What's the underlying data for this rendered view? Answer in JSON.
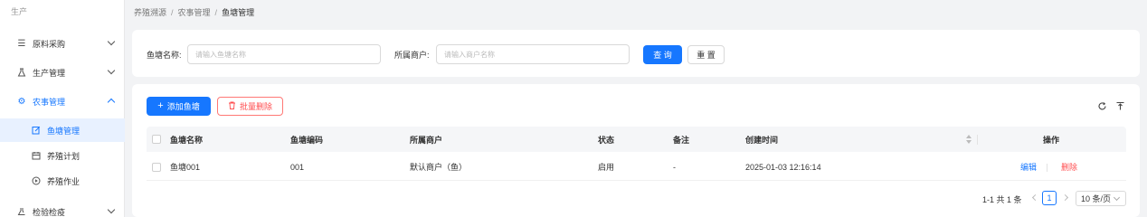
{
  "sidebar": {
    "brand": "生产",
    "items": [
      {
        "label": "原料采购",
        "icon": "list-icon"
      },
      {
        "label": "生产管理",
        "icon": "flask-icon"
      },
      {
        "label": "农事管理",
        "icon": "settings-icon"
      },
      {
        "label": "鱼塘管理",
        "icon": "edit-icon"
      },
      {
        "label": "养殖计划",
        "icon": "calendar-icon"
      },
      {
        "label": "养殖作业",
        "icon": "play-circle-icon"
      },
      {
        "label": "检验检疫",
        "icon": "experiment-icon"
      }
    ]
  },
  "breadcrumb": [
    "养殖溯源",
    "农事管理",
    "鱼塘管理"
  ],
  "search": {
    "pond_name_label": "鱼塘名称:",
    "pond_name_placeholder": "请输入鱼塘名称",
    "merchant_label": "所属商户:",
    "merchant_placeholder": "请输入商户名称",
    "query_button": "查 询",
    "reset_button": "重 置"
  },
  "toolbar": {
    "add_button": "添加鱼塘",
    "batch_delete_button": "批量删除"
  },
  "table": {
    "columns": [
      "鱼塘名称",
      "鱼塘编码",
      "所属商户",
      "状态",
      "备注",
      "创建时间",
      "操作"
    ],
    "rows": [
      {
        "name": "鱼塘001",
        "code": "001",
        "merchant": "默认商户（鱼）",
        "status": "启用",
        "remark": "-",
        "created": "2025-01-03 12:16:14",
        "edit": "编辑",
        "delete": "删除"
      }
    ]
  },
  "pagination": {
    "summary": "1-1 共 1 条",
    "current_page": "1",
    "page_size": "10 条/页"
  },
  "colors": {
    "primary": "#1677ff",
    "danger": "#ff4d4f"
  }
}
